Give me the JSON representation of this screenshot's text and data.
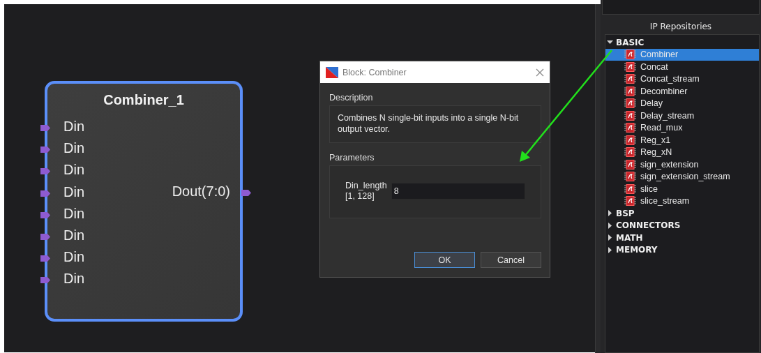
{
  "canvas": {
    "block": {
      "title": "Combiner_1",
      "inputs": [
        "Din",
        "Din",
        "Din",
        "Din",
        "Din",
        "Din",
        "Din",
        "Din"
      ],
      "outputs": [
        "Dout(7:0)"
      ],
      "selected": true
    }
  },
  "dialog": {
    "title": "Block: Combiner",
    "description_label": "Description",
    "description": "Combines N single-bit inputs into a single N-bit output vector.",
    "parameters_label": "Parameters",
    "parameters": [
      {
        "label": "Din_length",
        "range": "[1, 128]",
        "value": "8"
      }
    ],
    "buttons": [
      {
        "label": "OK",
        "selected": true
      },
      {
        "label": "Cancel",
        "selected": false
      }
    ]
  },
  "panel": {
    "title": "IP Repositories",
    "tree": [
      {
        "label": "BASIC",
        "expanded": true,
        "children": [
          {
            "label": "Combiner",
            "selected": true
          },
          {
            "label": "Concat",
            "selected": false
          },
          {
            "label": "Concat_stream",
            "selected": false
          },
          {
            "label": "Decombiner",
            "selected": false
          },
          {
            "label": "Delay",
            "selected": false
          },
          {
            "label": "Delay_stream",
            "selected": false
          },
          {
            "label": "Read_mux",
            "selected": false
          },
          {
            "label": "Reg_x1",
            "selected": false
          },
          {
            "label": "Reg_xN",
            "selected": false
          },
          {
            "label": "sign_extension",
            "selected": false
          },
          {
            "label": "sign_extension_stream",
            "selected": false
          },
          {
            "label": "slice",
            "selected": false
          },
          {
            "label": "slice_stream",
            "selected": false
          }
        ]
      },
      {
        "label": "BSP",
        "expanded": false
      },
      {
        "label": "CONNECTORS",
        "expanded": false
      },
      {
        "label": "MATH",
        "expanded": false
      },
      {
        "label": "MEMORY",
        "expanded": false
      }
    ]
  }
}
